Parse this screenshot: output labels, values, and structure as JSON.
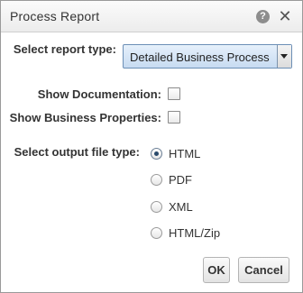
{
  "dialog": {
    "title": "Process Report",
    "help_icon_glyph": "?",
    "close_icon_glyph": "✕"
  },
  "report_type": {
    "label": "Select report type:",
    "selected": "Detailed Business Process"
  },
  "options": {
    "show_documentation": {
      "label": "Show Documentation:",
      "checked": false
    },
    "show_business_properties": {
      "label": "Show Business Properties:",
      "checked": false
    }
  },
  "output": {
    "label": "Select output file type:",
    "types": [
      {
        "label": "HTML",
        "checked": true
      },
      {
        "label": "PDF",
        "checked": false
      },
      {
        "label": "XML",
        "checked": false
      },
      {
        "label": "HTML/Zip",
        "checked": false
      }
    ]
  },
  "buttons": {
    "ok": "OK",
    "cancel": "Cancel"
  },
  "colors": {
    "select_accent": "#c7dbf1",
    "radio_selected_dot": "#2a4a6b"
  }
}
